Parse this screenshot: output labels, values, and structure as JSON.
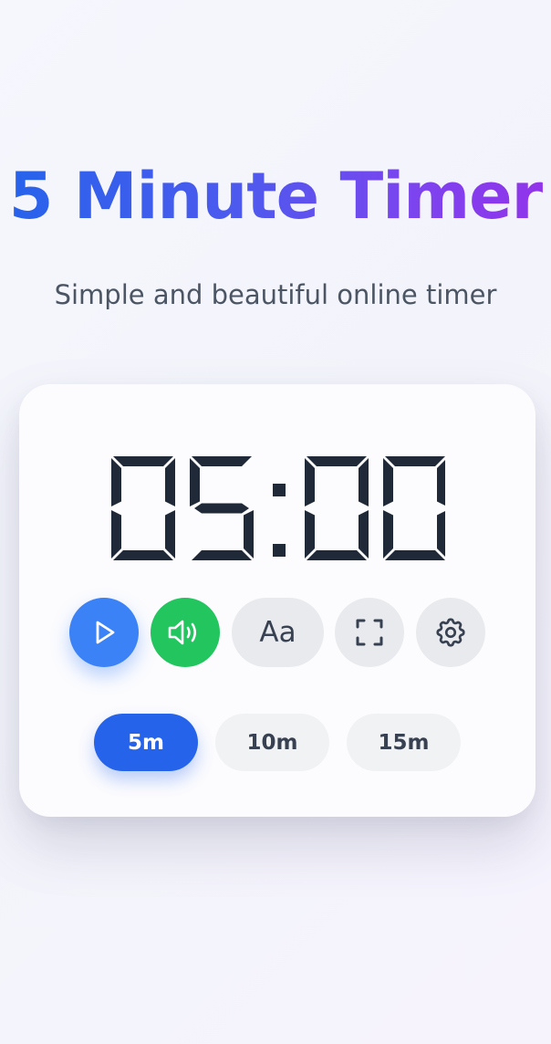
{
  "header": {
    "title": "5 Minute Timer",
    "subtitle": "Simple and beautiful online timer"
  },
  "timer": {
    "display": "05:00",
    "digit_color": "#1f2937"
  },
  "controls": {
    "play_icon": "play-icon",
    "sound_icon": "speaker-icon",
    "font_label": "Aa",
    "fullscreen_icon": "fullscreen-icon",
    "settings_icon": "gear-icon"
  },
  "presets": {
    "items": [
      {
        "label": "5m",
        "active": true
      },
      {
        "label": "10m",
        "active": false
      },
      {
        "label": "15m",
        "active": false
      }
    ]
  },
  "colors": {
    "play": "#3b82f6",
    "sound": "#22c55e",
    "active_preset": "#2563eb",
    "title_gradient_start": "#2563eb",
    "title_gradient_end": "#9333ea"
  }
}
